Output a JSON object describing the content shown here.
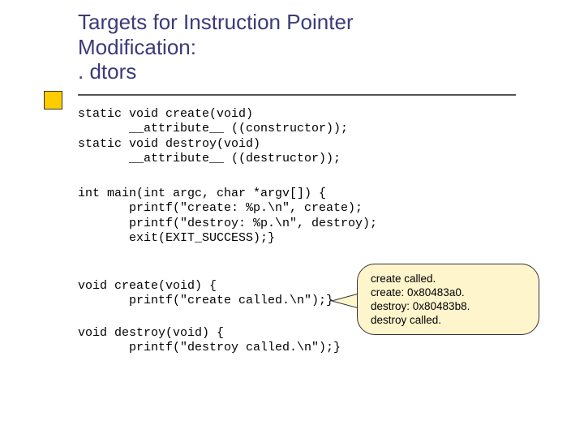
{
  "title_line1": "Targets for Instruction Pointer",
  "title_line2": "Modification:",
  "title_line3": ". dtors",
  "code_block1": "static void create(void)\n       __attribute__ ((constructor));\nstatic void destroy(void)\n       __attribute__ ((destructor));",
  "code_block2": "int main(int argc, char *argv[]) {\n       printf(\"create: %p.\\n\", create);\n       printf(\"destroy: %p.\\n\", destroy);\n       exit(EXIT_SUCCESS);}",
  "code_block3": "void create(void) {\n       printf(\"create called.\\n\");}",
  "code_block4": "void destroy(void) {\n       printf(\"destroy called.\\n\");}",
  "callout": {
    "l1": "create called.",
    "l2": "create: 0x80483a0.",
    "l3": "destroy: 0x80483b8.",
    "l4": "destroy called."
  }
}
